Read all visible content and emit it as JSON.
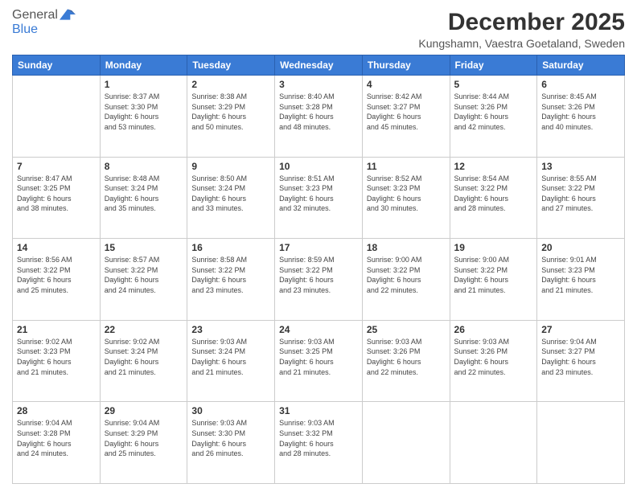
{
  "header": {
    "logo": {
      "line1": "General",
      "line2": "Blue"
    },
    "title": "December 2025",
    "subtitle": "Kungshamn, Vaestra Goetaland, Sweden"
  },
  "weekdays": [
    "Sunday",
    "Monday",
    "Tuesday",
    "Wednesday",
    "Thursday",
    "Friday",
    "Saturday"
  ],
  "weeks": [
    [
      {
        "day": "",
        "info": ""
      },
      {
        "day": "1",
        "info": "Sunrise: 8:37 AM\nSunset: 3:30 PM\nDaylight: 6 hours\nand 53 minutes."
      },
      {
        "day": "2",
        "info": "Sunrise: 8:38 AM\nSunset: 3:29 PM\nDaylight: 6 hours\nand 50 minutes."
      },
      {
        "day": "3",
        "info": "Sunrise: 8:40 AM\nSunset: 3:28 PM\nDaylight: 6 hours\nand 48 minutes."
      },
      {
        "day": "4",
        "info": "Sunrise: 8:42 AM\nSunset: 3:27 PM\nDaylight: 6 hours\nand 45 minutes."
      },
      {
        "day": "5",
        "info": "Sunrise: 8:44 AM\nSunset: 3:26 PM\nDaylight: 6 hours\nand 42 minutes."
      },
      {
        "day": "6",
        "info": "Sunrise: 8:45 AM\nSunset: 3:26 PM\nDaylight: 6 hours\nand 40 minutes."
      }
    ],
    [
      {
        "day": "7",
        "info": "Sunrise: 8:47 AM\nSunset: 3:25 PM\nDaylight: 6 hours\nand 38 minutes."
      },
      {
        "day": "8",
        "info": "Sunrise: 8:48 AM\nSunset: 3:24 PM\nDaylight: 6 hours\nand 35 minutes."
      },
      {
        "day": "9",
        "info": "Sunrise: 8:50 AM\nSunset: 3:24 PM\nDaylight: 6 hours\nand 33 minutes."
      },
      {
        "day": "10",
        "info": "Sunrise: 8:51 AM\nSunset: 3:23 PM\nDaylight: 6 hours\nand 32 minutes."
      },
      {
        "day": "11",
        "info": "Sunrise: 8:52 AM\nSunset: 3:23 PM\nDaylight: 6 hours\nand 30 minutes."
      },
      {
        "day": "12",
        "info": "Sunrise: 8:54 AM\nSunset: 3:22 PM\nDaylight: 6 hours\nand 28 minutes."
      },
      {
        "day": "13",
        "info": "Sunrise: 8:55 AM\nSunset: 3:22 PM\nDaylight: 6 hours\nand 27 minutes."
      }
    ],
    [
      {
        "day": "14",
        "info": "Sunrise: 8:56 AM\nSunset: 3:22 PM\nDaylight: 6 hours\nand 25 minutes."
      },
      {
        "day": "15",
        "info": "Sunrise: 8:57 AM\nSunset: 3:22 PM\nDaylight: 6 hours\nand 24 minutes."
      },
      {
        "day": "16",
        "info": "Sunrise: 8:58 AM\nSunset: 3:22 PM\nDaylight: 6 hours\nand 23 minutes."
      },
      {
        "day": "17",
        "info": "Sunrise: 8:59 AM\nSunset: 3:22 PM\nDaylight: 6 hours\nand 23 minutes."
      },
      {
        "day": "18",
        "info": "Sunrise: 9:00 AM\nSunset: 3:22 PM\nDaylight: 6 hours\nand 22 minutes."
      },
      {
        "day": "19",
        "info": "Sunrise: 9:00 AM\nSunset: 3:22 PM\nDaylight: 6 hours\nand 21 minutes."
      },
      {
        "day": "20",
        "info": "Sunrise: 9:01 AM\nSunset: 3:23 PM\nDaylight: 6 hours\nand 21 minutes."
      }
    ],
    [
      {
        "day": "21",
        "info": "Sunrise: 9:02 AM\nSunset: 3:23 PM\nDaylight: 6 hours\nand 21 minutes."
      },
      {
        "day": "22",
        "info": "Sunrise: 9:02 AM\nSunset: 3:24 PM\nDaylight: 6 hours\nand 21 minutes."
      },
      {
        "day": "23",
        "info": "Sunrise: 9:03 AM\nSunset: 3:24 PM\nDaylight: 6 hours\nand 21 minutes."
      },
      {
        "day": "24",
        "info": "Sunrise: 9:03 AM\nSunset: 3:25 PM\nDaylight: 6 hours\nand 21 minutes."
      },
      {
        "day": "25",
        "info": "Sunrise: 9:03 AM\nSunset: 3:26 PM\nDaylight: 6 hours\nand 22 minutes."
      },
      {
        "day": "26",
        "info": "Sunrise: 9:03 AM\nSunset: 3:26 PM\nDaylight: 6 hours\nand 22 minutes."
      },
      {
        "day": "27",
        "info": "Sunrise: 9:04 AM\nSunset: 3:27 PM\nDaylight: 6 hours\nand 23 minutes."
      }
    ],
    [
      {
        "day": "28",
        "info": "Sunrise: 9:04 AM\nSunset: 3:28 PM\nDaylight: 6 hours\nand 24 minutes."
      },
      {
        "day": "29",
        "info": "Sunrise: 9:04 AM\nSunset: 3:29 PM\nDaylight: 6 hours\nand 25 minutes."
      },
      {
        "day": "30",
        "info": "Sunrise: 9:03 AM\nSunset: 3:30 PM\nDaylight: 6 hours\nand 26 minutes."
      },
      {
        "day": "31",
        "info": "Sunrise: 9:03 AM\nSunset: 3:32 PM\nDaylight: 6 hours\nand 28 minutes."
      },
      {
        "day": "",
        "info": ""
      },
      {
        "day": "",
        "info": ""
      },
      {
        "day": "",
        "info": ""
      }
    ]
  ]
}
